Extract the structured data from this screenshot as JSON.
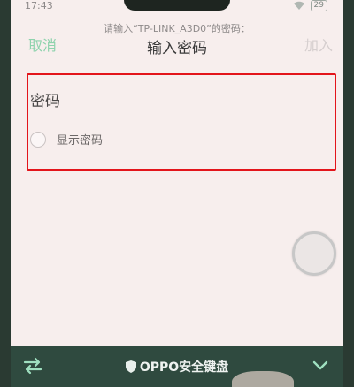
{
  "status": {
    "time": "17:43",
    "battery": "29"
  },
  "header": {
    "cancel_label": "取消",
    "subtitle": "请输入“TP-LINK_A3D0”的密码：",
    "title": "输入密码",
    "add_label": "加入"
  },
  "form": {
    "password_label": "密码",
    "password_value": "",
    "show_password_label": "显示密码"
  },
  "keyboard": {
    "title": "OPPO安全键盘"
  },
  "colors": {
    "accent_green": "#8ed3ad",
    "highlight_red": "#e3151b",
    "keyboard_bar": "#2f4a3f"
  }
}
